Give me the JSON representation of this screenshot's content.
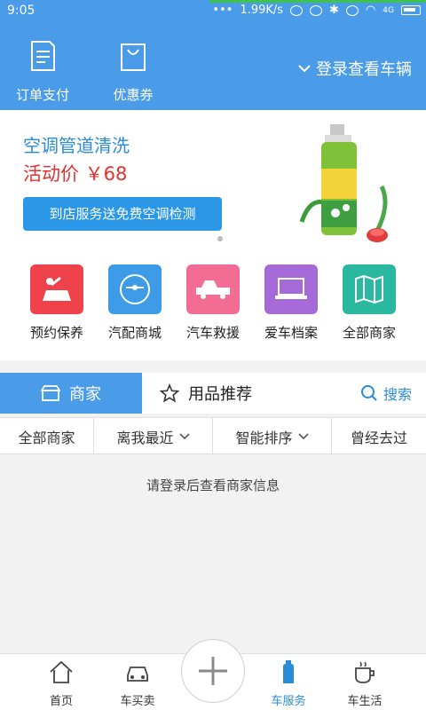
{
  "status_bar": {
    "time": "9:05",
    "speed": "1.99K/s",
    "network": "4G"
  },
  "header": {
    "order_pay_label": "订单支付",
    "coupon_label": "优惠券",
    "login_vehicle_label": "登录查看车辆"
  },
  "banner": {
    "title": "空调管道清洗",
    "price": "活动价 ￥68",
    "button_label": "到店服务送免费空调检测"
  },
  "categories": [
    {
      "label": "预约保养",
      "icon": "car-repair-icon",
      "color": "#f0424a"
    },
    {
      "label": "汽配商城",
      "icon": "gauge-icon",
      "color": "#3d9be8"
    },
    {
      "label": "汽车救援",
      "icon": "tow-truck-icon",
      "color": "#f36c93"
    },
    {
      "label": "爱车档案",
      "icon": "laptop-icon",
      "color": "#a56ad8"
    },
    {
      "label": "全部商家",
      "icon": "map-icon",
      "color": "#2ab8a0"
    }
  ],
  "tabs": {
    "merchants": "商家",
    "products": "用品推荐",
    "search": "搜索"
  },
  "filters": [
    "全部商家",
    "离我最近",
    "智能排序",
    "曾经去过"
  ],
  "empty_message": "请登录后查看商家信息",
  "bottom_nav": [
    {
      "label": "首页",
      "icon": "home-icon"
    },
    {
      "label": "车买卖",
      "icon": "car-icon"
    },
    {
      "label": "车服务",
      "icon": "bottle-icon"
    },
    {
      "label": "车生活",
      "icon": "coffee-cup-icon"
    }
  ],
  "colors": {
    "brand": "#4a9be8",
    "price": "#e2312f",
    "link": "#2a8cd8"
  }
}
